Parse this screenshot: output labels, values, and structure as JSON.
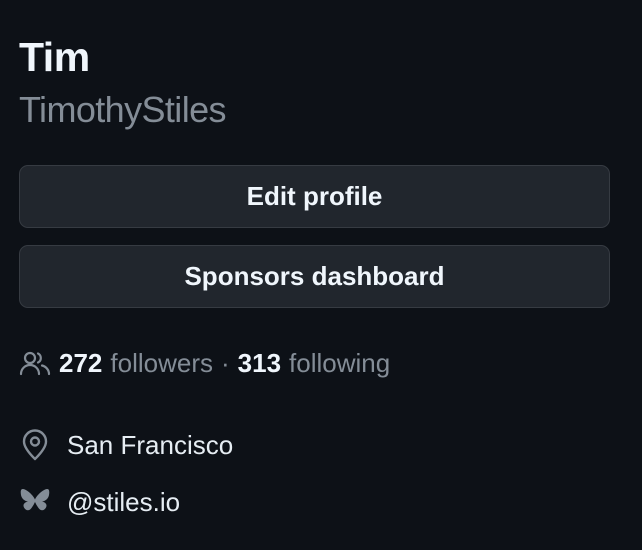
{
  "profile": {
    "name": "Tim",
    "username": "TimothyStiles",
    "edit_profile_label": "Edit profile",
    "sponsors_dashboard_label": "Sponsors dashboard",
    "followers_count": "272",
    "followers_label": "followers",
    "separator": "·",
    "following_count": "313",
    "following_label": "following",
    "location": "San Francisco",
    "social_handle": "@stiles.io"
  },
  "icons": {
    "followers": "people-icon",
    "location": "location-pin-icon",
    "social": "bluesky-butterfly-icon"
  },
  "colors": {
    "background": "#0d1117",
    "button_bg": "#21262d",
    "button_border": "#363b42",
    "text_primary": "#f0f6fc",
    "text_muted": "#848d97"
  }
}
